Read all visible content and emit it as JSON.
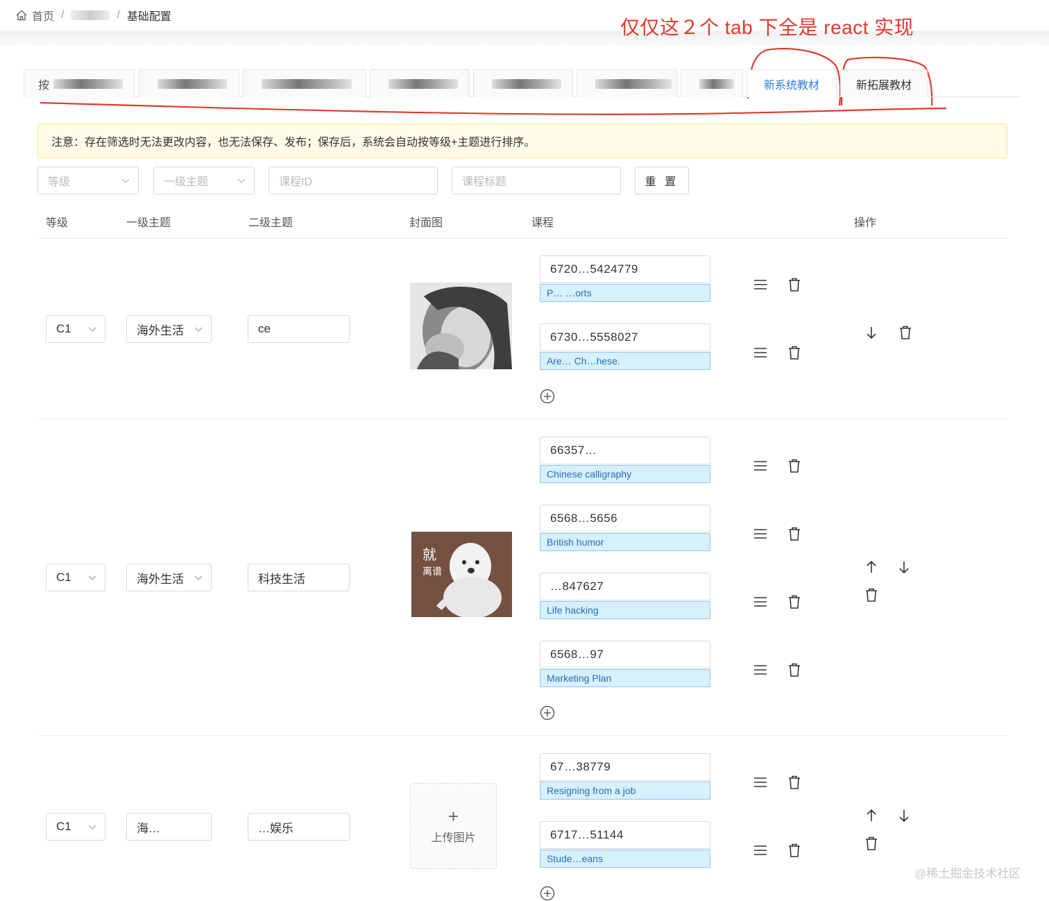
{
  "breadcrumb": {
    "home": "首页",
    "separator": "/",
    "current": "基础配置"
  },
  "annotation": {
    "text": "仅仅这２个 tab 下全是 react 实现"
  },
  "tabs": [
    {
      "label": "按"
    },
    {
      "label": ""
    },
    {
      "label": ""
    },
    {
      "label": ""
    },
    {
      "label": ""
    },
    {
      "label": ""
    },
    {
      "label": ""
    },
    {
      "label": "新系统教材"
    },
    {
      "label": "新拓展教材"
    }
  ],
  "notice": {
    "text": "注意：存在筛选时无法更改内容，也无法保存、发布；保存后，系统会自动按等级+主题进行排序。"
  },
  "filters": {
    "level_placeholder": "等级",
    "topic_placeholder": "一级主题",
    "course_id_placeholder": "课程ID",
    "course_title_placeholder": "课程标题",
    "reset_label": "重 置"
  },
  "columns": {
    "level": "等级",
    "topic1": "一级主题",
    "topic2": "二级主题",
    "cover": "封面图",
    "course": "课程",
    "actions": "操作"
  },
  "rows": [
    {
      "level": "C1",
      "topic1": "海外生活",
      "topic2": "ce",
      "courses": [
        {
          "id": "6720…5424779",
          "title": "P… …orts"
        },
        {
          "id": "6730…5558027",
          "title": "Are… Ch…hese."
        }
      ]
    },
    {
      "level": "C1",
      "topic1": "海外生活",
      "topic2": "科技生活",
      "cover_text_big": "就",
      "cover_text_small": "离谱",
      "courses": [
        {
          "id": "66357…",
          "title": "Chinese calligraphy"
        },
        {
          "id": "6568…5656",
          "title": "British humor"
        },
        {
          "id": "…847627",
          "title": "Life hacking"
        },
        {
          "id": "6568…97",
          "title": "Marketing Plan"
        }
      ]
    },
    {
      "level": "C1",
      "topic1": "海…",
      "topic2": "…娱乐",
      "upload_plus": "+",
      "upload_label": "上传图片",
      "courses": [
        {
          "id": "67…38779",
          "title": "Resigning from a job"
        },
        {
          "id": "6717…51144",
          "title": "Stude…eans"
        }
      ]
    }
  ],
  "watermark": "@稀土掘金技术社区",
  "colors": {
    "accent": "#2f7ed8",
    "annotation": "#e03a2f",
    "notice_bg": "#fffbe6",
    "course_title_bg": "#d6f0fc"
  }
}
